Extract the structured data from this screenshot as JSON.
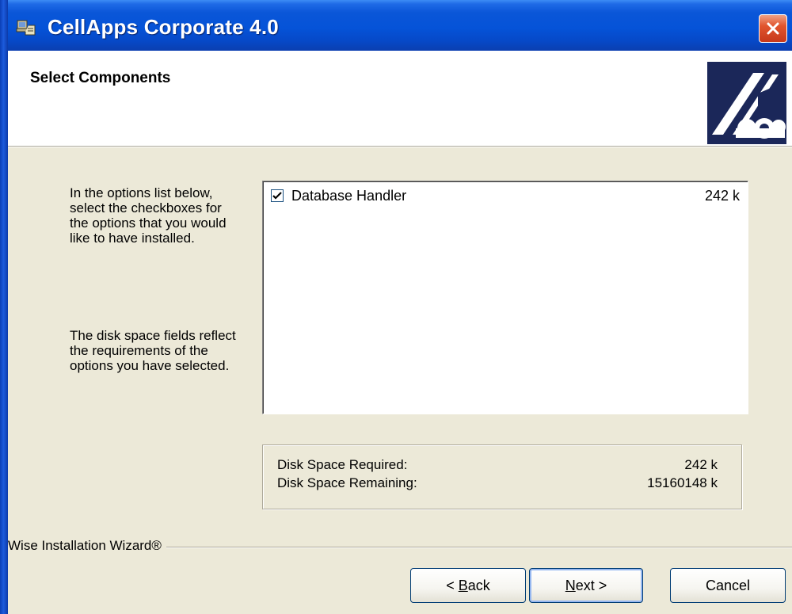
{
  "window": {
    "title": "CellApps Corporate 4.0",
    "icons": {
      "app": "installer-app-icon",
      "close": "close-icon"
    }
  },
  "header": {
    "title": "Select Components",
    "logo": "wise-installer-logo"
  },
  "description": {
    "paragraph1": "In the options list below, select the checkboxes for the options that you would like to have installed.",
    "paragraph2": "The disk space fields reflect the requirements of the options you have selected."
  },
  "components": [
    {
      "label": "Database Handler",
      "size": "242 k",
      "checked": true
    }
  ],
  "disk_space": {
    "required_label": "Disk Space Required:",
    "required_value": "242 k",
    "remaining_label": "Disk Space Remaining:",
    "remaining_value": "15160148 k"
  },
  "branding": {
    "text": "Wise Installation Wizard®"
  },
  "buttons": {
    "back_prefix": "< ",
    "back_mnemonic": "B",
    "back_rest": "ack",
    "next_mnemonic": "N",
    "next_rest": "ext >",
    "cancel": "Cancel"
  },
  "colors": {
    "titlebar": "#0553d8",
    "dialog_bg": "#ece9d8",
    "close_button": "#e1552e"
  }
}
